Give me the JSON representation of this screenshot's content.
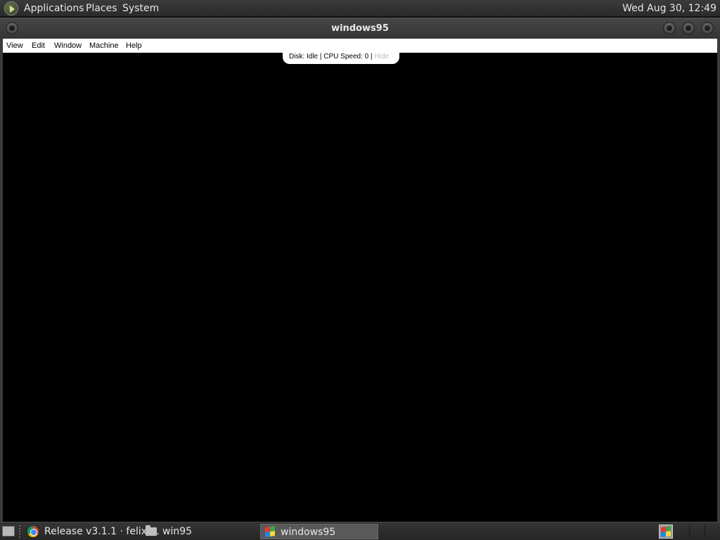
{
  "top_panel": {
    "menus": [
      "Applications",
      "Places",
      "System"
    ],
    "clock": "Wed Aug 30, 12:49"
  },
  "window": {
    "title": "windows95",
    "menubar": [
      "View",
      "Edit",
      "Window",
      "Machine",
      "Help"
    ],
    "status": {
      "text": "Disk: Idle | CPU Speed: 0 |",
      "hide_label": "Hide"
    }
  },
  "taskbar": {
    "tasks": [
      {
        "label": "Release v3.1.1 · felixr...",
        "icon": "chrome-icon"
      },
      {
        "label": "win95",
        "icon": "folder-icon"
      },
      {
        "label": "windows95",
        "icon": "windows-logo-icon",
        "active": true
      }
    ]
  }
}
